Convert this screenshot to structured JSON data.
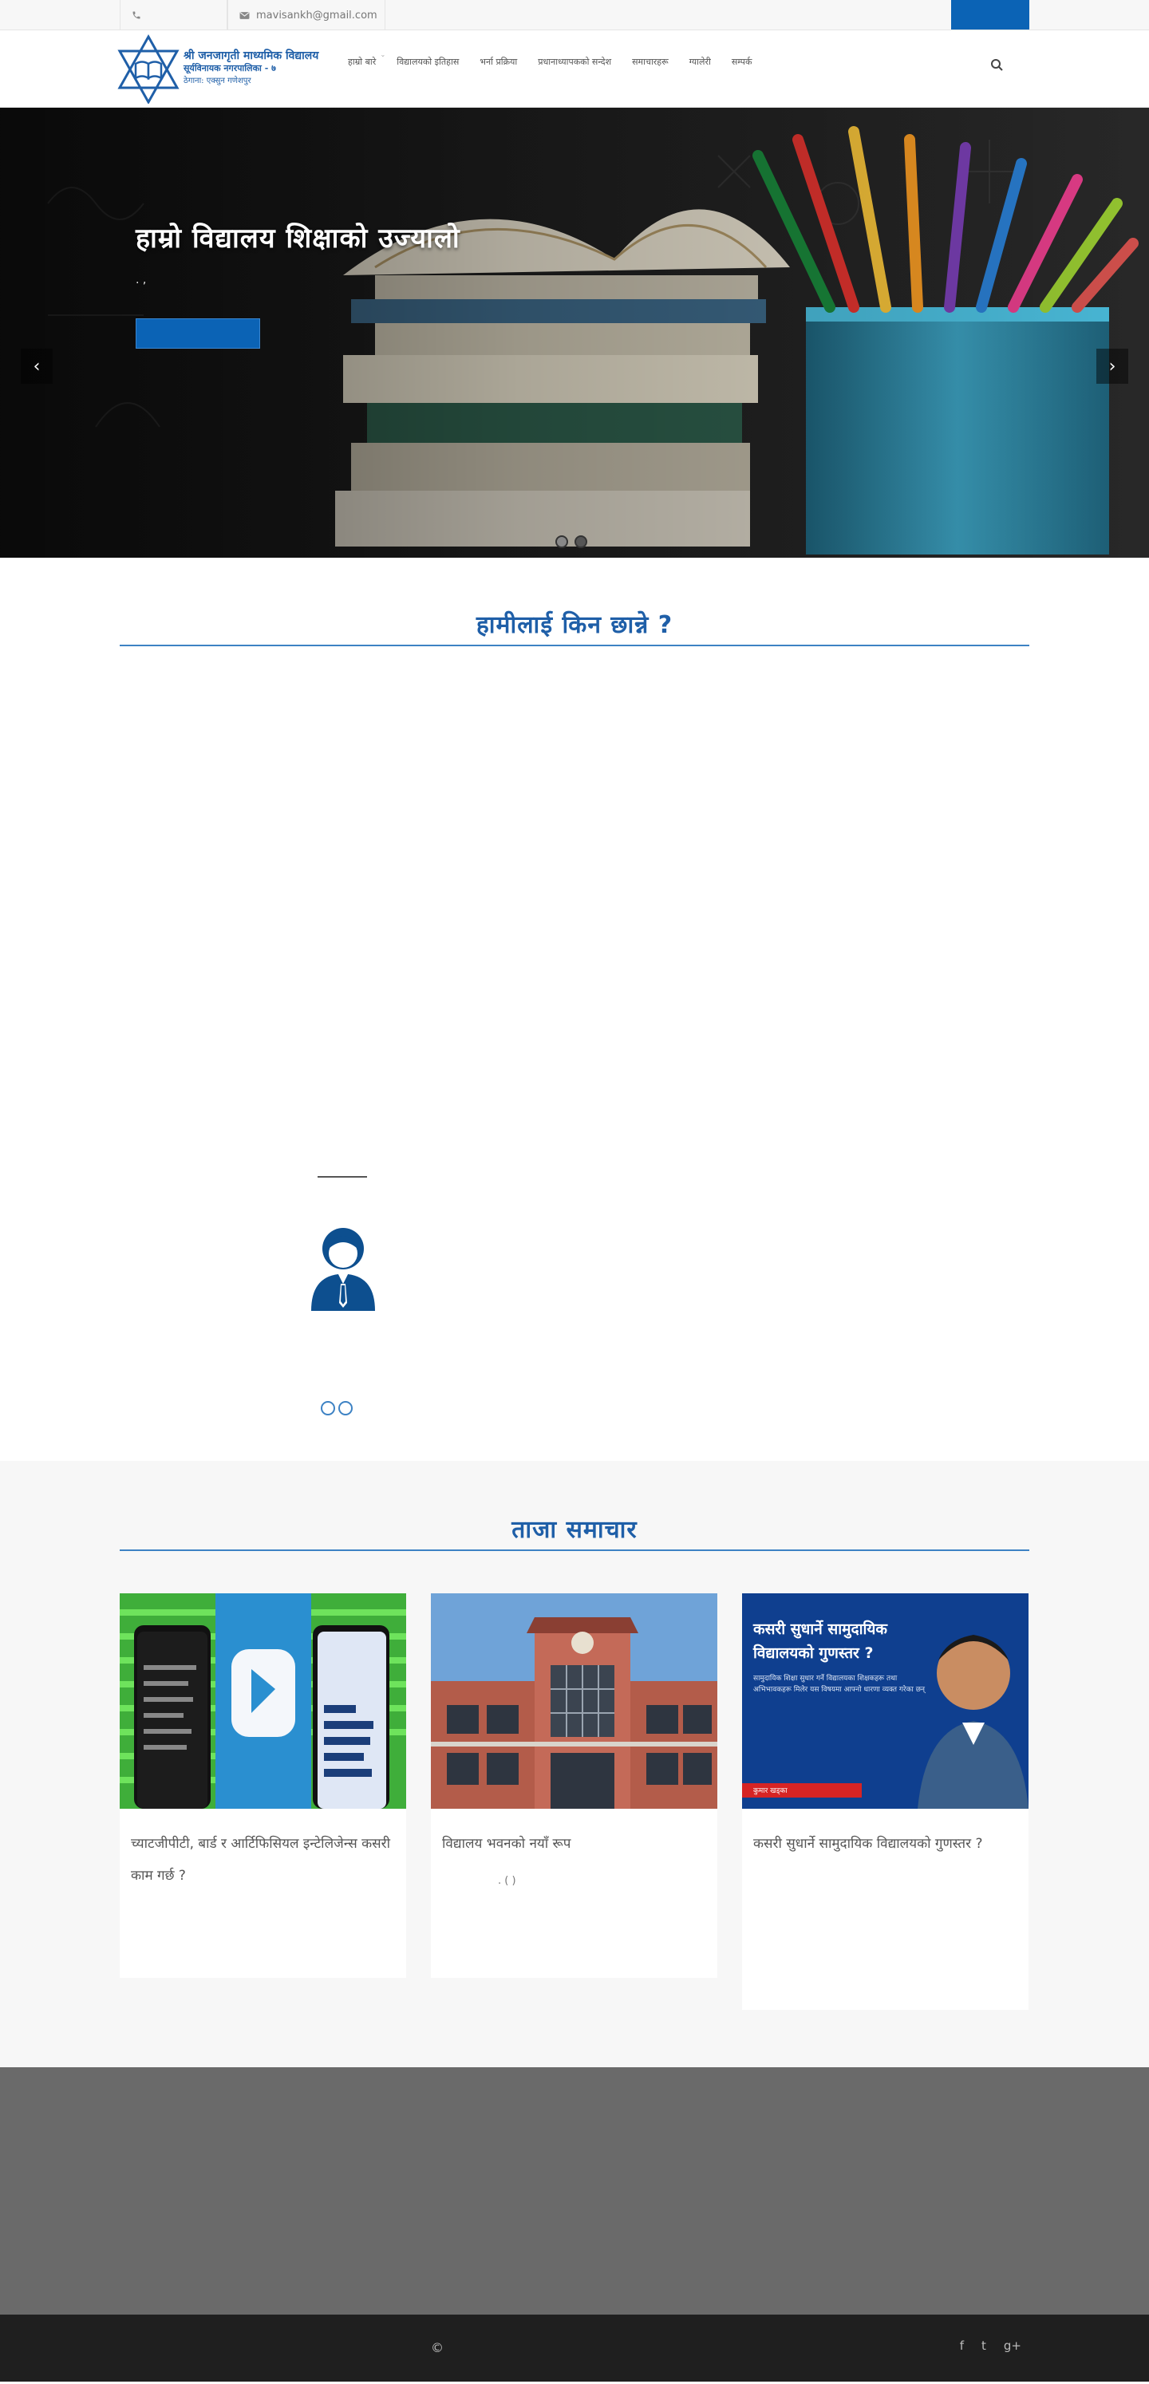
{
  "topbar": {
    "phone_icon": "phone-icon",
    "email_icon": "envelope-icon",
    "email": "mavisankh@gmail.com"
  },
  "logo": {
    "line1": "श्री जनजागृती माध्यमिक विद्यालय",
    "line2": "सूर्यविनायक नगरपालिका - ७",
    "line3": "ठेगाना: एक्सुन गणेशपुर"
  },
  "nav": {
    "items": [
      {
        "label": "हाम्रो बारे",
        "has_caret": true
      },
      {
        "label": "विद्यालयको इतिहास"
      },
      {
        "label": "भर्ना प्रक्रिया"
      },
      {
        "label": "प्रधानाध्यापकको सन्देश"
      },
      {
        "label": "समाचारहरू"
      },
      {
        "label": "ग्यालेरी"
      },
      {
        "label": "सम्पर्क"
      }
    ]
  },
  "hero": {
    "title": "हाम्रो विद्यालय शिक्षाको उज्यालो",
    "subtitle": ". ,",
    "arrow_left": "‹",
    "arrow_right": "›"
  },
  "why": {
    "title": "हामीलाई किन छान्ने ?"
  },
  "news": {
    "title": "ताजा समाचार",
    "cards": [
      {
        "title": "च्याटजीपीटी, बार्ड र आर्टिफिसियल इन्टेलिजेन्स कसरी काम गर्छ ?",
        "excerpt": ""
      },
      {
        "title": "विद्यालय भवनको नयाँ रूप",
        "excerpt": ". ( )"
      },
      {
        "title": "कसरी सुधार्ने सामुदायिक विद्यालयको गुणस्तर ?",
        "excerpt": ""
      }
    ]
  },
  "card3_image": {
    "headline": "कसरी सुधार्ने सामुदायिक विद्यालयको गुणस्तर ?",
    "body": "सामुदायिक शिक्षा सुधार गर्ने विद्यालयका शिक्षकहरू तथा अभिभावकहरू मिलेर यस विषयमा आफ्नो धारणा व्यक्त गरेका छन्",
    "tag": "कुमार खड्का"
  },
  "footer": {
    "copyright": "©",
    "social": [
      "f",
      "t",
      "g+"
    ]
  },
  "colors": {
    "primary": "#0b63b5",
    "heading": "#1f5fa8",
    "footer": "#1f1f1f",
    "band": "#6a6a6a"
  }
}
